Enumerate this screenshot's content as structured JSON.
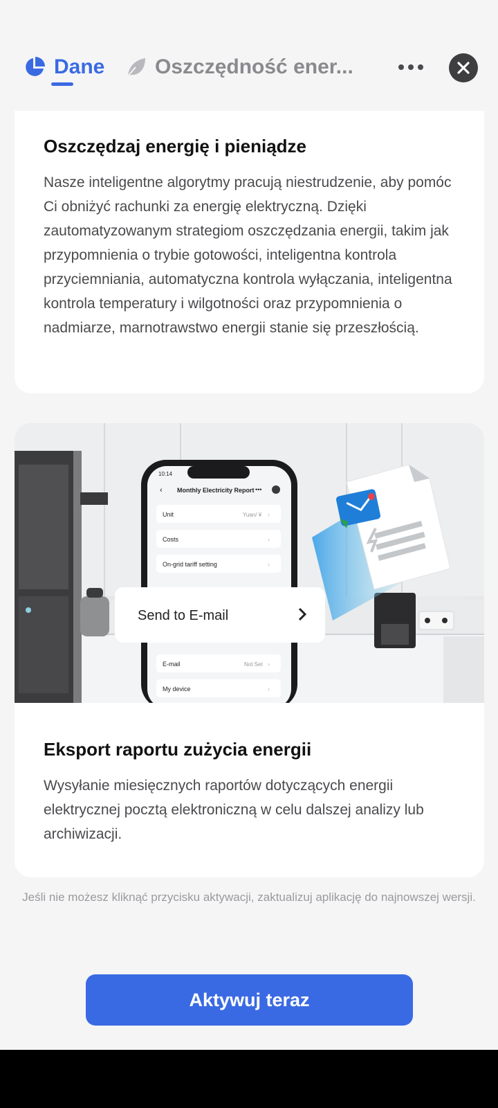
{
  "tabs": {
    "data_label": "Dane",
    "energy_label": "Oszczędność ener..."
  },
  "icons": {
    "data_tab": "pie-chart-icon",
    "energy_tab": "leaf-icon",
    "more": "more-dots-icon",
    "close": "close-icon",
    "email": "email-icon",
    "report": "report-document-icon",
    "chevron": "chevron-right-icon"
  },
  "colors": {
    "accent": "#3a6ae3",
    "background": "#f5f5f6",
    "card": "#ffffff",
    "close_button": "#3e3e40"
  },
  "card_energy": {
    "title": "Oszczędzaj energię i pieniądze",
    "body": "Nasze inteligentne algorytmy pracują niestrudzenie, aby pomóc Ci obniżyć rachunki za energię elektryczną. Dzięki zautomatyzowanym strategiom oszczędzania energii, takim jak przypomnienia o trybie gotowości, inteligentna kontrola przyciemniania, automatyczna kontrola wyłączania, inteligentna kontrola temperatury i wilgotności oraz przypomnienia o nadmiarze, marnotrawstwo energii stanie się przeszłością."
  },
  "card_report": {
    "title": "Eksport raportu zużycia energii",
    "body": "Wysyłanie miesięcznych raportów dotyczących energii elektrycznej pocztą elektroniczną w celu dalszej analizy lub archiwizacji.",
    "illustration": {
      "time": "10:14",
      "screen_title": "Monthly Electricity Report",
      "rows_top": [
        {
          "label": "Unit",
          "value": "Yuan/ ¥"
        },
        {
          "label": "Costs",
          "value": ""
        },
        {
          "label": "On-grid tariff setting",
          "value": ""
        }
      ],
      "rows_bottom": [
        {
          "label": "E-mail",
          "value": "Not Set"
        },
        {
          "label": "My device",
          "value": ""
        }
      ],
      "popup_label": "Send to E-mail"
    }
  },
  "update_note": "Jeśli nie możesz kliknąć przycisku aktywacji, zaktualizuj aplikację do najnowszej wersji.",
  "activate_label": "Aktywuj teraz"
}
